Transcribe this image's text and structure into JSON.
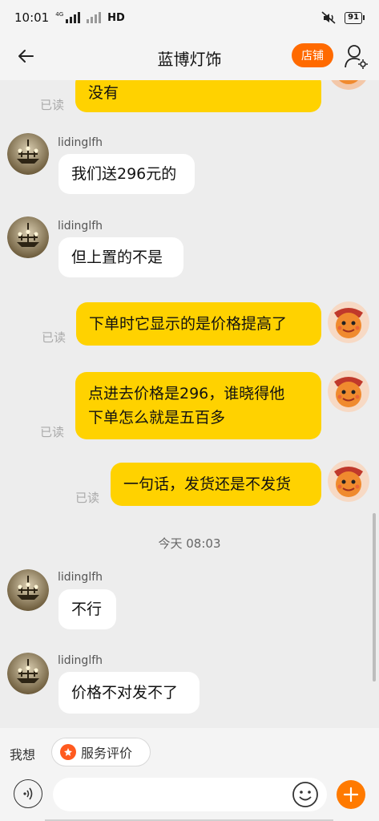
{
  "status_bar": {
    "time": "10:01",
    "net_tag": "4G",
    "hd": "HD",
    "battery": "91"
  },
  "header": {
    "title": "蓝博灯饰",
    "shop_button": "店铺"
  },
  "messages": [
    {
      "text": "没有",
      "read": "已读"
    },
    {
      "user": "lidinglfh",
      "text": "我们送296元的"
    },
    {
      "user": "lidinglfh",
      "text": "但上置的不是"
    },
    {
      "text": "下单时它显示的是价格提高了",
      "read": "已读"
    },
    {
      "lines": [
        "点进去价格是296，谁晓得他",
        "下单怎么就是五百多"
      ],
      "read": "已读"
    },
    {
      "text": "一句话，发货还是不发货",
      "read": "已读"
    },
    {
      "timestamp": "今天  08:03"
    },
    {
      "user": "lidinglfh",
      "text": "不行"
    },
    {
      "user": "lidinglfh",
      "text": "价格不对发不了"
    }
  ],
  "quick_bar": {
    "label": "我想",
    "chip": "服务评价"
  },
  "input": {
    "placeholder": ""
  },
  "colors": {
    "accent": "#ff6a00",
    "my_bubble": "#ffd200",
    "their_bubble": "#ffffff",
    "background": "#ededed"
  },
  "icons": [
    "back-arrow-icon",
    "user-settings-icon",
    "voice-icon",
    "emoji-icon",
    "plus-icon",
    "service-rating-icon",
    "signal-icon",
    "mute-icon",
    "battery-icon"
  ]
}
